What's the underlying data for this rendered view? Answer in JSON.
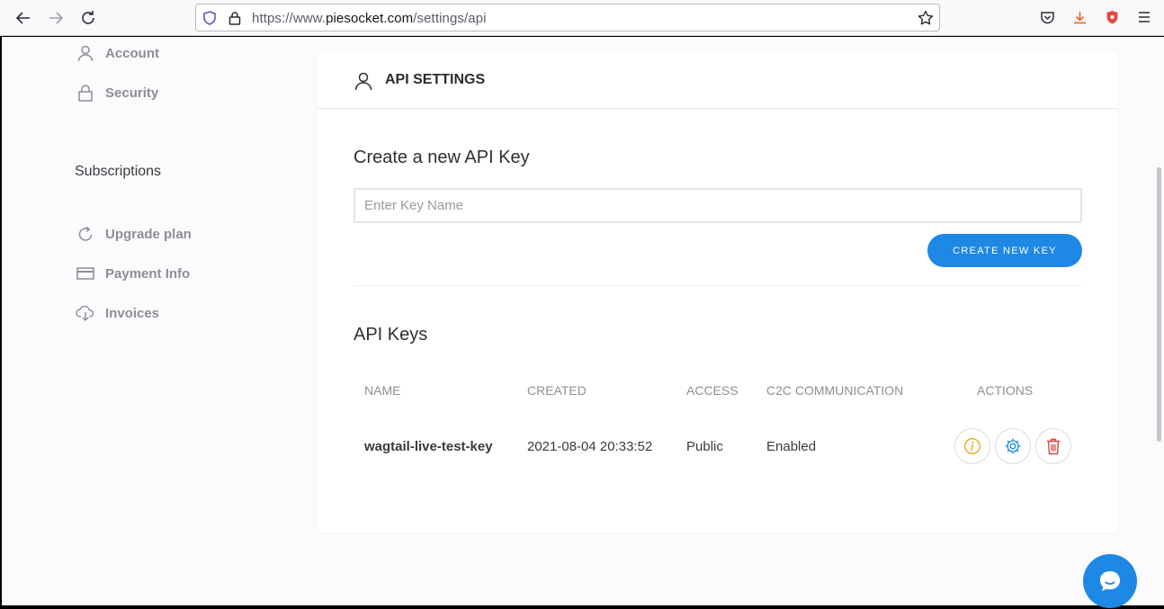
{
  "browser": {
    "url_prefix": "https://www.",
    "url_host": "piesocket.com",
    "url_path": "/settings/api"
  },
  "sidebar": {
    "top_items": [
      {
        "label": "Account",
        "icon": "user-icon"
      },
      {
        "label": "Security",
        "icon": "lock-icon"
      }
    ],
    "subscriptions_heading": "Subscriptions",
    "sub_items": [
      {
        "label": "Upgrade plan",
        "icon": "refresh-icon"
      },
      {
        "label": "Payment Info",
        "icon": "credit-card-icon"
      },
      {
        "label": "Invoices",
        "icon": "cloud-download-icon"
      }
    ]
  },
  "card": {
    "title": "API SETTINGS",
    "create_title": "Create a new API Key",
    "input_placeholder": "Enter Key Name",
    "create_button": "CREATE NEW KEY",
    "keys_title": "API Keys"
  },
  "table": {
    "headers": [
      "NAME",
      "CREATED",
      "ACCESS",
      "C2C COMMUNICATION",
      "ACTIONS"
    ],
    "rows": [
      {
        "name": "wagtail-live-test-key",
        "created": "2021-08-04 20:33:52",
        "access": "Public",
        "c2c": "Enabled"
      }
    ]
  },
  "colors": {
    "accent": "#1e88e5",
    "info": "#e6a817",
    "settings": "#1e88e5",
    "delete": "#d9453d"
  }
}
